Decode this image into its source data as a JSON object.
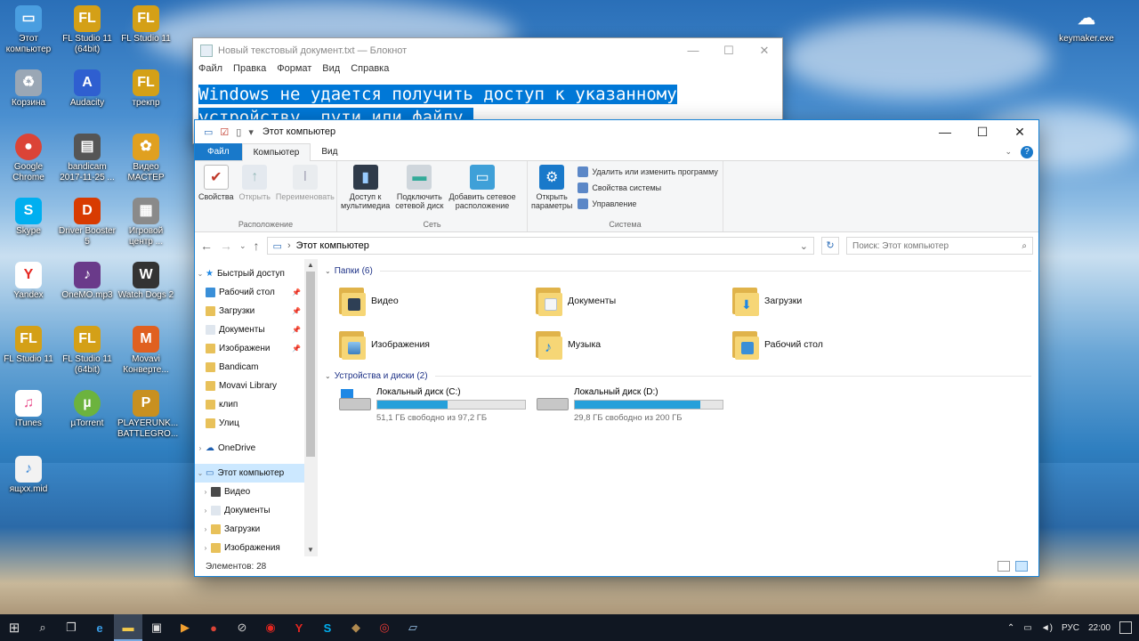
{
  "desktop": {
    "icons": [
      {
        "label": "Этот компьютер",
        "glyph": "PC",
        "color": "#4a9ee0"
      },
      {
        "label": "FL Studio 11 (64bit)",
        "glyph": "FL",
        "color": "#d4a017"
      },
      {
        "label": "FL Studio 11",
        "glyph": "FL",
        "color": "#d4a017"
      },
      {
        "label": "Корзина",
        "glyph": "♻",
        "color": "#9aa7b5"
      },
      {
        "label": "Audacity",
        "glyph": "A",
        "color": "#2f5fd0"
      },
      {
        "label": "трекпр",
        "glyph": "FL",
        "color": "#d4a017"
      },
      {
        "label": "Google Chrome",
        "glyph": "G",
        "color": "#db4437"
      },
      {
        "label": "bandicam 2017-11-25 ...",
        "glyph": "▤",
        "color": "#555"
      },
      {
        "label": "Видео МАСТЕР",
        "glyph": "✿",
        "color": "#e0a020"
      },
      {
        "label": "Skype",
        "glyph": "S",
        "color": "#00aff0"
      },
      {
        "label": "Driver Booster 5",
        "glyph": "D",
        "color": "#d83b01"
      },
      {
        "label": "Игровой центр ...",
        "glyph": "▦",
        "color": "#8a8a8a"
      },
      {
        "label": "Yandex",
        "glyph": "Y",
        "color": "#e52620"
      },
      {
        "label": "OneMO.mp3",
        "glyph": "♪",
        "color": "#6a3a8a"
      },
      {
        "label": "Watch Dogs 2",
        "glyph": "W",
        "color": "#333"
      },
      {
        "label": "FL Studio 11",
        "glyph": "FL",
        "color": "#d4a017"
      },
      {
        "label": "FL Studio 11 (64bit)",
        "glyph": "FL",
        "color": "#d4a017"
      },
      {
        "label": "Movavi Конверте...",
        "glyph": "M",
        "color": "#e06020"
      },
      {
        "label": "iTunes",
        "glyph": "♫",
        "color": "#e84c8a"
      },
      {
        "label": "µTorrent",
        "glyph": "µ",
        "color": "#6cb33e"
      },
      {
        "label": "PLAYERUNK... BATTLEGRO...",
        "glyph": "P",
        "color": "#c89020"
      },
      {
        "label": "ящхх.mid",
        "glyph": "♪",
        "color": "#4a90d9"
      }
    ],
    "keymaker": "keymaker.exe"
  },
  "notepad": {
    "title": "Новый текстовый документ.txt — Блокнот",
    "menu": [
      "Файл",
      "Правка",
      "Формат",
      "Вид",
      "Справка"
    ],
    "line1": "Windows не удается получить доступ к указанному ",
    "line2": "устройству, пути или файлу."
  },
  "explorer": {
    "title": "Этот компьютер",
    "tabs": {
      "file": "Файл",
      "computer": "Компьютер",
      "view": "Вид"
    },
    "ribbon": {
      "location": {
        "label": "Расположение",
        "props": "Свойства",
        "open": "Открыть",
        "rename": "Переименовать"
      },
      "network": {
        "label": "Сеть",
        "media1": "Доступ к",
        "media2": "мультимедиа",
        "map1": "Подключить",
        "map2": "сетевой диск",
        "addloc1": "Добавить сетевое",
        "addloc2": "расположение"
      },
      "system": {
        "label": "Система",
        "open1": "Открыть",
        "open2": "параметры",
        "uninstall": "Удалить или изменить программу",
        "sysprops": "Свойства системы",
        "manage": "Управление"
      }
    },
    "address": "Этот компьютер",
    "search_placeholder": "Поиск: Этот компьютер",
    "nav": {
      "quick": "Быстрый доступ",
      "items": [
        "Рабочий стол",
        "Загрузки",
        "Документы",
        "Изображени",
        "Bandicam",
        "Movavi Library",
        "клип",
        "Улиц"
      ],
      "onedrive": "OneDrive",
      "thispc": "Этот компьютер",
      "pc_items": [
        "Видео",
        "Документы",
        "Загрузки",
        "Изображения"
      ]
    },
    "folders_header": "Папки (6)",
    "folders": [
      "Видео",
      "Документы",
      "Загрузки",
      "Изображения",
      "Музыка",
      "Рабочий стол"
    ],
    "drives_header": "Устройства и диски (2)",
    "drives": [
      {
        "name": "Локальный диск (C:)",
        "free": "51,1 ГБ свободно из 97,2 ГБ",
        "used_fraction": 0.474
      },
      {
        "name": "Локальный диск (D:)",
        "free": "29,8 ГБ свободно из 200 ГБ",
        "used_fraction": 0.851
      }
    ],
    "status": "Элементов: 28"
  },
  "taskbar": {
    "lang": "РУС",
    "time": "22:00"
  }
}
